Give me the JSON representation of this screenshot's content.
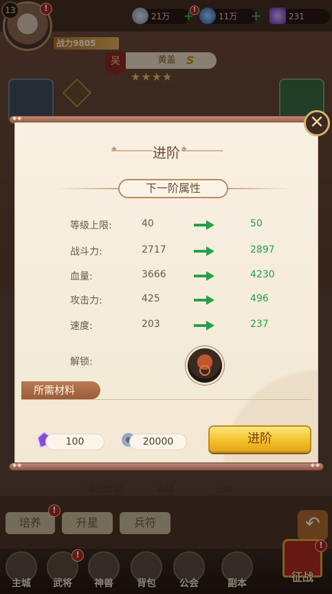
{
  "status_bar": {
    "level": "13",
    "power_label": "战力9805",
    "resources": [
      {
        "name": "silver-coin",
        "value": "21万"
      },
      {
        "name": "blue-gem",
        "value": "11万"
      },
      {
        "name": "purple-crystal",
        "value": "231"
      }
    ]
  },
  "hero": {
    "faction": "吴",
    "name": "黄盖",
    "grade": "S",
    "stars": "★★★★"
  },
  "modal": {
    "title": "进阶",
    "subtitle": "下一阶属性",
    "close_glyph": "✕",
    "attributes": [
      {
        "name": "等级上限:",
        "current": "40",
        "next": "50"
      },
      {
        "name": "战斗力:",
        "current": "2717",
        "next": "2897"
      },
      {
        "name": "血量:",
        "current": "3666",
        "next": "4230"
      },
      {
        "name": "攻击力:",
        "current": "425",
        "next": "496"
      },
      {
        "name": "速度:",
        "current": "203",
        "next": "237"
      }
    ],
    "unlock_label": "解锁:",
    "materials_label": "所需材料",
    "materials": [
      {
        "icon": "purple-crystal-icon",
        "value": "100"
      },
      {
        "icon": "silver-coin-icon",
        "value": "20000"
      }
    ],
    "advance_button": "进阶"
  },
  "skills": [
    "落帆焚舰",
    "诈降",
    "苦肉"
  ],
  "tabs": [
    "培养",
    "升星",
    "兵符"
  ],
  "nav": [
    "主城",
    "武将",
    "神兽",
    "背包",
    "公会",
    "副本"
  ],
  "battle_button": "征战",
  "colors": {
    "paper": "#f7eedd",
    "next_value_green": "#23a04a",
    "advance_gold": "#f3c22a",
    "material_tab": "#9a5c3a"
  }
}
